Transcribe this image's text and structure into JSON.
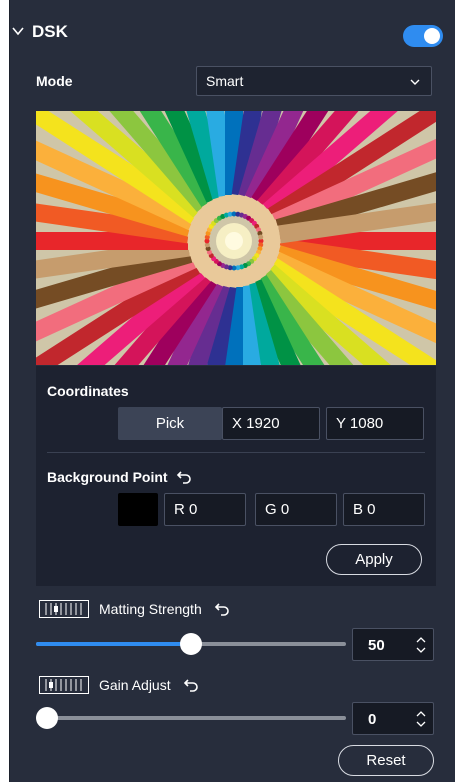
{
  "header": {
    "title": "DSK",
    "enabled": true
  },
  "mode": {
    "label": "Mode",
    "value": "Smart"
  },
  "coordinates": {
    "label": "Coordinates",
    "pick_label": "Pick",
    "x_value": "X  1920",
    "y_value": "Y  1080"
  },
  "background_point": {
    "label": "Background Point",
    "color": "#000000",
    "r_value": "R  0",
    "g_value": "G  0",
    "b_value": "B  0",
    "apply_label": "Apply"
  },
  "matting_strength": {
    "label": "Matting Strength",
    "value": "50",
    "level": 0.5
  },
  "gain_adjust": {
    "label": "Gain Adjust",
    "value": "0",
    "level": 0
  },
  "reset_label": "Reset",
  "colors": {
    "accent": "#2f8cf0",
    "panel": "#272d3c"
  }
}
